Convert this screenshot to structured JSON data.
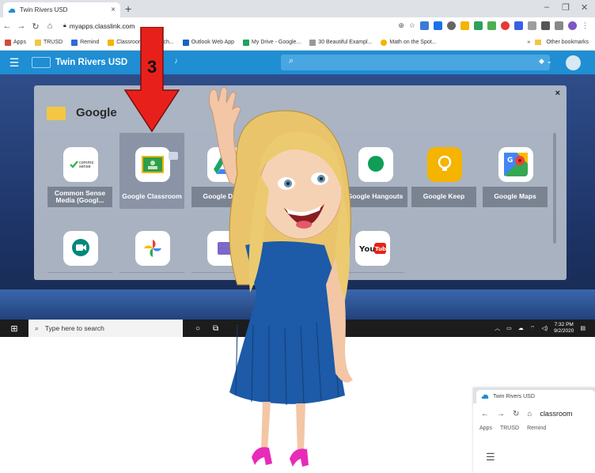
{
  "browser": {
    "tab_title": "Twin Rivers USD",
    "tab_close": "×",
    "new_tab": "+",
    "url": "myapps.classlink.com",
    "window_controls": [
      "–",
      "❐",
      "✕"
    ]
  },
  "bookmarks": {
    "items": [
      "Apps",
      "TRUSD",
      "Remind",
      "Classroom",
      "Search...",
      "Outlook Web App",
      "My Drive - Google...",
      "30 Beautiful Exampl...",
      "Math on the Spot..."
    ],
    "more": "»",
    "other": "Other bookmarks"
  },
  "classlink": {
    "district": "Twin Rivers USD"
  },
  "folder": {
    "title": "Google",
    "close": "×",
    "apps": [
      {
        "label": "Common Sense Media (Googl...",
        "icon": "common-sense-icon"
      },
      {
        "label": "Google Classroom",
        "icon": "google-classroom-icon"
      },
      {
        "label": "Google Drive",
        "icon": "google-drive-icon"
      },
      {
        "label": "Google Hangouts",
        "icon": "google-hangouts-icon"
      },
      {
        "label": "Google Keep",
        "icon": "google-keep-icon"
      },
      {
        "label": "Google Maps",
        "icon": "google-maps-icon"
      }
    ],
    "row2": [
      "google-meet-icon",
      "google-photos-icon",
      "google-slides-icon",
      "youtube-icon"
    ]
  },
  "annotation": {
    "step": "3"
  },
  "taskbar": {
    "search_placeholder": "Type here to search",
    "time": "7:32 PM",
    "date": "9/2/2020"
  },
  "mini_browser": {
    "tab_title": "Twin Rivers USD",
    "url": "classroom",
    "bookmarks": [
      "Apps",
      "TRUSD",
      "Remind"
    ]
  },
  "colors": {
    "classlink_blue": "#1f8ed3",
    "arrow_red": "#e8201b",
    "highlight": "#8a94a6"
  }
}
